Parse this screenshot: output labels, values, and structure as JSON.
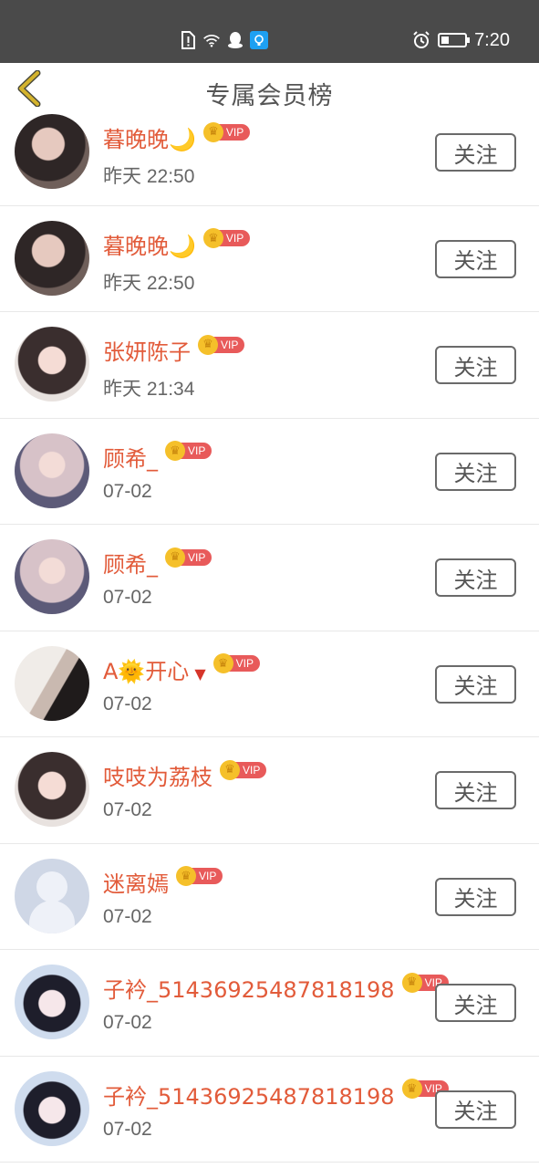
{
  "status_bar": {
    "time": "7:20",
    "icons": [
      "alert-sim-icon",
      "wifi-icon",
      "qq-icon",
      "app-icon",
      "alarm-icon",
      "battery-icon"
    ]
  },
  "header": {
    "title": "专属会员榜",
    "back_icon": "chevron-left-icon",
    "back_color": "#d4b32c"
  },
  "members": [
    {
      "name": "暮晚晚🌙",
      "time": "昨天 22:50",
      "vip": "VIP",
      "follow": "关注"
    },
    {
      "name": "暮晚晚🌙",
      "time": "昨天 22:50",
      "vip": "VIP",
      "follow": "关注"
    },
    {
      "name": "张妍陈子",
      "time": "昨天 21:34",
      "vip": "VIP",
      "follow": "关注"
    },
    {
      "name": "顾希_",
      "time": "07-02",
      "vip": "VIP",
      "follow": "关注"
    },
    {
      "name": "顾希_",
      "time": "07-02",
      "vip": "VIP",
      "follow": "关注"
    },
    {
      "name": "A🌞开心",
      "extra": "▼",
      "time": "07-02",
      "vip": "VIP",
      "follow": "关注"
    },
    {
      "name": "吱吱为荔枝",
      "time": "07-02",
      "vip": "VIP",
      "follow": "关注"
    },
    {
      "name": "迷离嫣",
      "time": "07-02",
      "vip": "VIP",
      "follow": "关注"
    },
    {
      "name": "子衿_51436925487818198",
      "time": "07-02",
      "vip": "VIP",
      "follow": "关注"
    },
    {
      "name": "子衿_51436925487818198",
      "time": "07-02",
      "vip": "VIP",
      "follow": "关注"
    }
  ],
  "colors": {
    "name": "#e25b3a",
    "vip_badge": "#e85a5a",
    "crown": "#f5c02a",
    "status_bar": "#4a4a4a"
  }
}
